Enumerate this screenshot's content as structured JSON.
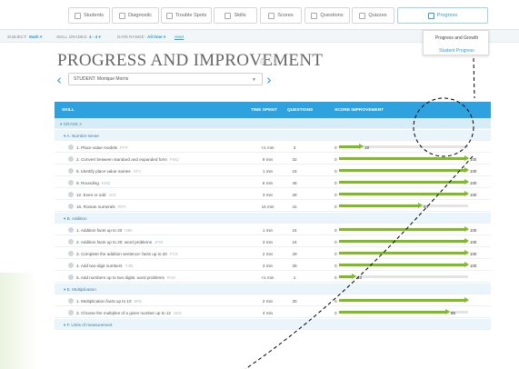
{
  "nav": {
    "items": [
      {
        "label": "Students",
        "icon": "students-icon"
      },
      {
        "label": "Diagnostic",
        "icon": "diagnostic-icon"
      },
      {
        "label": "Trouble Spots",
        "icon": "trouble-spots-icon"
      },
      {
        "label": "Skills",
        "icon": "skills-icon"
      },
      {
        "label": "Scores",
        "icon": "scores-icon"
      },
      {
        "label": "Questions",
        "icon": "questions-icon"
      },
      {
        "label": "Quizzes",
        "icon": "quizzes-icon"
      },
      {
        "label": "Progress",
        "icon": "progress-icon"
      }
    ],
    "active_color": "#2d9cdb"
  },
  "filters": {
    "subject_label": "SUBJECT:",
    "subject_value": "Math ▾",
    "grades_label": "SKILL GRADES:",
    "grades_value": "4 - 4 ▾",
    "range_label": "DATE RANGE:",
    "range_value": "All time ▾",
    "reset": "reset"
  },
  "dropdown": {
    "items": [
      "Progress and Growth",
      "Student Progress"
    ]
  },
  "page": {
    "title": "PROGRESS AND IMPROVEMENT",
    "student_label": "STUDENT:",
    "student_value": "Monique Morris"
  },
  "table": {
    "headers": [
      "SKILL",
      "TIME SPENT",
      "QUESTIONS",
      "SCORE IMPROVEMENT"
    ],
    "header_color": "#2ea2df",
    "bar_color": "#7cbe1f",
    "rows": [
      {
        "kind": "grade",
        "label": "▾  GRADE 4"
      },
      {
        "kind": "section",
        "label": "▾  A. Number sense"
      },
      {
        "kind": "skill",
        "name": "1. Place value models",
        "code": "FFP",
        "time": "<1 min",
        "questions": "3",
        "start": "0",
        "score": "18",
        "fraction": 0.18
      },
      {
        "kind": "skill",
        "name": "2. Convert between standard and expanded form",
        "code": "FNQ",
        "time": "9 min",
        "questions": "32",
        "start": "0",
        "score": "100",
        "fraction": 1.0
      },
      {
        "kind": "skill",
        "name": "6. Identify place value names",
        "code": "SFJ",
        "time": "1 min",
        "questions": "16",
        "start": "0",
        "score": "100",
        "fraction": 1.0
      },
      {
        "kind": "skill",
        "name": "9. Rounding",
        "code": "KM2",
        "time": "6 min",
        "questions": "48",
        "start": "0",
        "score": "100",
        "fraction": 1.0
      },
      {
        "kind": "skill",
        "name": "12. Even or odd",
        "code": "JAZ",
        "time": "3 min",
        "questions": "28",
        "start": "0",
        "score": "100",
        "fraction": 1.0
      },
      {
        "kind": "skill",
        "name": "16. Roman numerals",
        "code": "RPA",
        "time": "14 min",
        "questions": "41",
        "start": "0",
        "score": "64",
        "fraction": 0.64
      },
      {
        "kind": "section",
        "label": "▾  B. Addition"
      },
      {
        "kind": "skill",
        "name": "1. Addition facts up to 20",
        "code": "N86",
        "time": "1 min",
        "questions": "24",
        "start": "0",
        "score": "100",
        "fraction": 1.0
      },
      {
        "kind": "skill",
        "name": "2. Addition facts up to 20: word problems",
        "code": "JFM",
        "time": "3 min",
        "questions": "24",
        "start": "0",
        "score": "100",
        "fraction": 1.0
      },
      {
        "kind": "skill",
        "name": "3. Complete the addition sentence: facts up to 20",
        "code": "FC6",
        "time": "2 min",
        "questions": "29",
        "start": "0",
        "score": "100",
        "fraction": 1.0
      },
      {
        "kind": "skill",
        "name": "4. Add two-digit numbers",
        "code": "Y4B",
        "time": "3 min",
        "questions": "28",
        "start": "0",
        "score": "100",
        "fraction": 1.0
      },
      {
        "kind": "skill",
        "name": "5. Add numbers up to two digits: word problems",
        "code": "RXZ",
        "time": "<1 min",
        "questions": "1",
        "start": "0",
        "score": "13",
        "fraction": 0.13
      },
      {
        "kind": "section",
        "label": "▾  E. Multiplication"
      },
      {
        "kind": "skill",
        "name": "1. Multiplication facts up to 10",
        "code": "9R5",
        "time": "2 min",
        "questions": "30",
        "start": "0",
        "score": "",
        "fraction": 1.0
      },
      {
        "kind": "skill",
        "name": "3. Choose the multiples of a given number up to 12",
        "code": "SK8",
        "time": "4 min",
        "questions": "",
        "start": "0",
        "score": "85",
        "fraction": 0.85
      },
      {
        "kind": "section",
        "label": "▾  F. Units of measurement"
      }
    ]
  }
}
